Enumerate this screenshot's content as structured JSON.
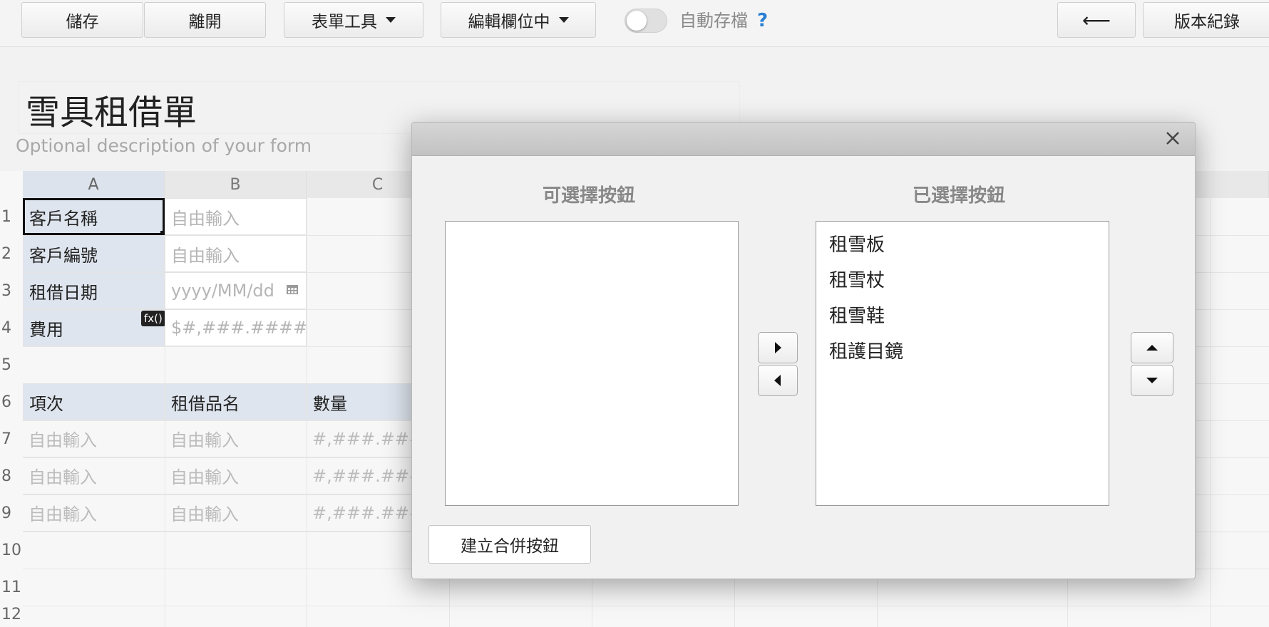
{
  "toolbar": {
    "save": "儲存",
    "leave": "離開",
    "form_tools": "表單工具",
    "editing_field": "編輯欄位中",
    "autosave": "自動存檔",
    "help": "?",
    "back": "⟵",
    "history": "版本紀錄",
    "autosave_on": false
  },
  "form": {
    "title": "雪具租借單",
    "description": "Optional description of your form"
  },
  "sheet": {
    "columns": [
      "A",
      "B",
      "C"
    ],
    "rows": [
      "1",
      "2",
      "3",
      "4",
      "5",
      "6",
      "7",
      "8",
      "9",
      "10",
      "11",
      "12"
    ],
    "r1": {
      "label": "客戶名稱",
      "input": "自由輸入"
    },
    "r2": {
      "label": "客戶編號",
      "input": "自由輸入"
    },
    "r3": {
      "label": "租借日期",
      "input": "yyyy/MM/dd"
    },
    "r4": {
      "label": "費用",
      "input": "$#,###.#####",
      "fx": "fx()"
    },
    "r6": {
      "a": "項次",
      "b": "租借品名",
      "c": "數量"
    },
    "r7": {
      "a": "自由輸入",
      "b": "自由輸入",
      "c": "#,###.####"
    },
    "r8": {
      "a": "自由輸入",
      "b": "自由輸入",
      "c": "#,###.####"
    },
    "r9": {
      "a": "自由輸入",
      "b": "自由輸入",
      "c": "#,###.####"
    }
  },
  "modal": {
    "available_title": "可選擇按鈕",
    "selected_title": "已選擇按鈕",
    "available_items": [],
    "selected_items": [
      "租雪板",
      "租雪杖",
      "租雪鞋",
      "租護目鏡"
    ],
    "create_merge_button": "建立合併按鈕"
  }
}
